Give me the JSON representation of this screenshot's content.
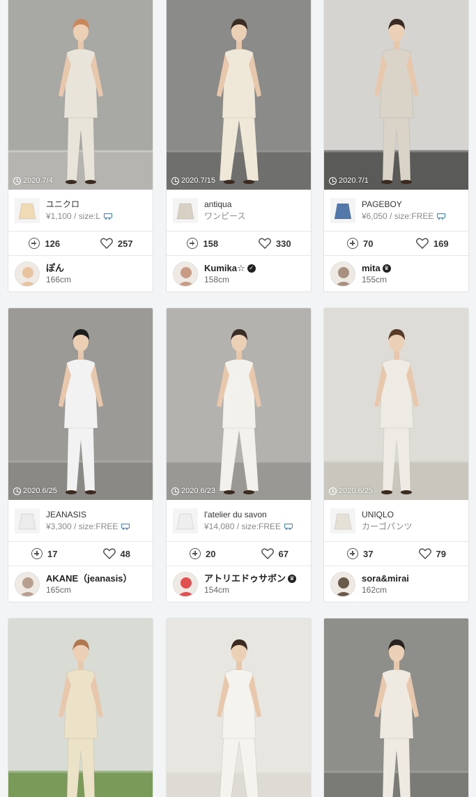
{
  "cards": [
    {
      "date": "2020.7/4",
      "brand": "ユニクロ",
      "sub": "¥1,100 / size:L",
      "cart": true,
      "clips": "126",
      "likes": "257",
      "user": "ぽん",
      "height": "166cm",
      "badge": "",
      "colors": {
        "bg": "#a8a8a4",
        "floor": "#b5b4b0",
        "outfit": "#e9e4da",
        "hair": "#c9875a",
        "thumb": "#f0d9b5",
        "avatar": "#e8c3a0"
      }
    },
    {
      "date": "2020.7/15",
      "brand": "antiqua",
      "sub": "ワンピース",
      "cart": false,
      "clips": "158",
      "likes": "330",
      "user": "Kumika☆",
      "height": "158cm",
      "badge": "check",
      "colors": {
        "bg": "#8b8c8a",
        "floor": "#6f706e",
        "outfit": "#efe7d8",
        "hair": "#3b2c24",
        "thumb": "#d8d0c2",
        "avatar": "#c89c84"
      }
    },
    {
      "date": "2020.7/1",
      "brand": "PAGEBOY",
      "sub": "¥6,050 / size:FREE",
      "cart": true,
      "clips": "70",
      "likes": "169",
      "user": "mita",
      "height": "155cm",
      "badge": "crown",
      "colors": {
        "bg": "#d5d4d0",
        "floor": "#5a5a58",
        "outfit": "#d9d3c8",
        "hair": "#3a2a22",
        "thumb": "#5277a8",
        "avatar": "#a89080"
      }
    },
    {
      "date": "2020.6/25",
      "brand": "JEANASIS",
      "sub": "¥3,300 / size:FREE",
      "cart": true,
      "clips": "17",
      "likes": "48",
      "user": "AKANE（jeanasis）",
      "height": "165cm",
      "badge": "",
      "colors": {
        "bg": "#9c9a96",
        "floor": "#8b8985",
        "outfit": "#f2f2f2",
        "hair": "#1c1c1c",
        "thumb": "#ececec",
        "avatar": "#b79f90"
      }
    },
    {
      "date": "2020.6/23",
      "brand": "l'atelier du savon",
      "sub": "¥14,080 / size:FREE",
      "cart": true,
      "clips": "20",
      "likes": "67",
      "user": "アトリエドゥサボン",
      "height": "154cm",
      "badge": "crown",
      "colors": {
        "bg": "#b4b2ae",
        "floor": "#9a9894",
        "outfit": "#f3f1ec",
        "hair": "#3a2c26",
        "thumb": "#eeeeee",
        "avatar": "#e05050"
      }
    },
    {
      "date": "2020.6/25",
      "brand": "UNIQLO",
      "sub": "カーゴパンツ",
      "cart": false,
      "clips": "37",
      "likes": "79",
      "user": "sora&mirai",
      "height": "162cm",
      "badge": "",
      "colors": {
        "bg": "#dedcd6",
        "floor": "#c9c6be",
        "outfit": "#eeebe4",
        "hair": "#5a3a28",
        "thumb": "#e6e1d6",
        "avatar": "#6a5a4a"
      }
    },
    {
      "date": "",
      "brand": "",
      "sub": "",
      "cart": false,
      "clips": "",
      "likes": "",
      "user": "",
      "height": "",
      "badge": "",
      "colors": {
        "bg": "#d9dcd4",
        "floor": "#7a9a5a",
        "outfit": "#ece2c8",
        "hair": "#b07850",
        "thumb": "#ffffff",
        "avatar": "#ffffff"
      }
    },
    {
      "date": "",
      "brand": "",
      "sub": "",
      "cart": false,
      "clips": "",
      "likes": "",
      "user": "",
      "height": "",
      "badge": "",
      "colors": {
        "bg": "#e8e6e0",
        "floor": "#dedbd4",
        "outfit": "#f5f3ee",
        "hair": "#3a2a20",
        "thumb": "#ffffff",
        "avatar": "#ffffff"
      }
    },
    {
      "date": "",
      "brand": "",
      "sub": "",
      "cart": false,
      "clips": "",
      "likes": "",
      "user": "",
      "height": "",
      "badge": "",
      "colors": {
        "bg": "#8e8e8a",
        "floor": "#7a7a76",
        "outfit": "#eeeae2",
        "hair": "#2a2220",
        "thumb": "#ffffff",
        "avatar": "#ffffff"
      }
    }
  ]
}
